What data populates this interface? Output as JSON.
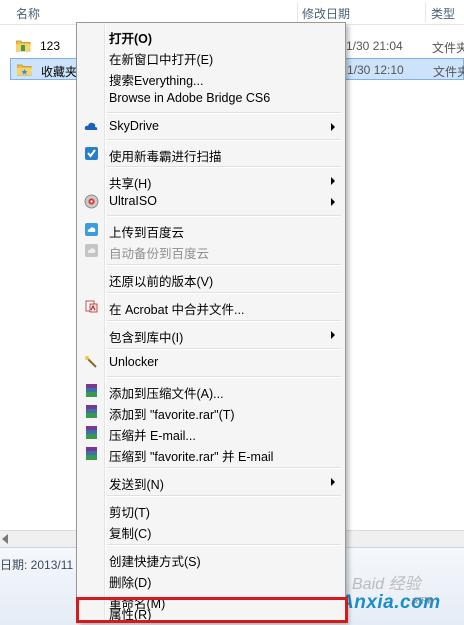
{
  "columns": {
    "name": "名称",
    "modified": "修改日期",
    "type": "类型"
  },
  "files": [
    {
      "name": "123",
      "date": "1/30 21:04",
      "type": "文件夹"
    },
    {
      "name": "收藏夹",
      "date": "1/30 12:10",
      "type": "文件夹"
    }
  ],
  "details": {
    "text": "日期: 2013/11"
  },
  "watermark": {
    "text": "Baid 经验"
  },
  "logo": {
    "text": "Anxia.com",
    "sub": "安下载"
  },
  "menu": {
    "items": [
      {
        "label": "打开(O)"
      },
      {
        "label": "在新窗口中打开(E)"
      },
      {
        "label": "搜索Everything..."
      },
      {
        "label": "Browse in Adobe Bridge CS6"
      },
      {
        "label": "SkyDrive"
      },
      {
        "label": "使用新毒霸进行扫描"
      },
      {
        "label": "共享(H)"
      },
      {
        "label": "UltraISO"
      },
      {
        "label": "上传到百度云"
      },
      {
        "label": "自动备份到百度云"
      },
      {
        "label": "还原以前的版本(V)"
      },
      {
        "label": "在 Acrobat 中合并文件..."
      },
      {
        "label": "包含到库中(I)"
      },
      {
        "label": "Unlocker"
      },
      {
        "label": "添加到压缩文件(A)..."
      },
      {
        "label": "添加到 \"favorite.rar\"(T)"
      },
      {
        "label": "压缩并 E-mail..."
      },
      {
        "label": "压缩到 \"favorite.rar\" 并 E-mail"
      },
      {
        "label": "发送到(N)"
      },
      {
        "label": "剪切(T)"
      },
      {
        "label": "复制(C)"
      },
      {
        "label": "创建快捷方式(S)"
      },
      {
        "label": "删除(D)"
      },
      {
        "label": "重命名(M)"
      },
      {
        "label": "属性(R)"
      }
    ]
  },
  "colors": {
    "selection": "#cce3fb",
    "highlight_box": "#d51a1a",
    "menu_bg": "#f5f5f5"
  }
}
